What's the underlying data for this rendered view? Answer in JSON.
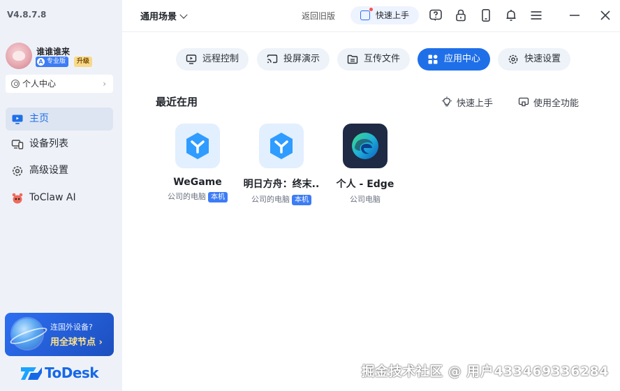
{
  "app": {
    "version": "V4.8.7.8",
    "brand_name": "ToDesk",
    "brand_color": "#1668e8",
    "accent_color": "#1f6fe8"
  },
  "user": {
    "name": "谁谁谁来",
    "plan_badge": "专业版",
    "upgrade_label": "升级",
    "personal_center_label": "个人中心"
  },
  "sidebar": {
    "items": [
      {
        "label": "主页",
        "icon": "monitor-icon",
        "active": true
      },
      {
        "label": "设备列表",
        "icon": "devices-icon",
        "active": false
      },
      {
        "label": "高级设置",
        "icon": "gear-icon",
        "active": false
      },
      {
        "label": "ToClaw AI",
        "icon": "toclaw-ai-icon",
        "active": false
      }
    ],
    "promo": {
      "line1": "连国外设备?",
      "line2": "用全球节点 ›"
    }
  },
  "header": {
    "scene_label": "通用场景",
    "old_version_label": "返回旧版",
    "quickstart_label": "快速上手",
    "icons": [
      "help-icon",
      "lock-icon",
      "phone-icon",
      "bell-icon",
      "menu-icon"
    ],
    "window_controls": [
      "minimize-icon",
      "close-icon"
    ]
  },
  "tabs": [
    {
      "label": "远程控制",
      "icon": "remote-control-icon",
      "active": false
    },
    {
      "label": "投屏演示",
      "icon": "cast-screen-icon",
      "active": false
    },
    {
      "label": "互传文件",
      "icon": "file-transfer-icon",
      "active": false
    },
    {
      "label": "应用中心",
      "icon": "app-center-icon",
      "active": true
    },
    {
      "label": "快速设置",
      "icon": "settings-icon",
      "active": false
    }
  ],
  "recent": {
    "title": "最近在用",
    "quickstart_link": "快速上手",
    "all_features_link": "使用全功能",
    "apps": [
      {
        "name": "WeGame",
        "meta": "公司的电脑",
        "tag": "本机",
        "icon": "wegame-icon"
      },
      {
        "name": "明日方舟：终末..",
        "meta": "公司的电脑",
        "tag": "本机",
        "icon": "wegame-icon"
      },
      {
        "name": "个人 - Edge",
        "meta": "公司电脑",
        "tag": "",
        "icon": "edge-icon"
      }
    ]
  },
  "watermark": "掘金技术社区 @ 用户433469336284"
}
